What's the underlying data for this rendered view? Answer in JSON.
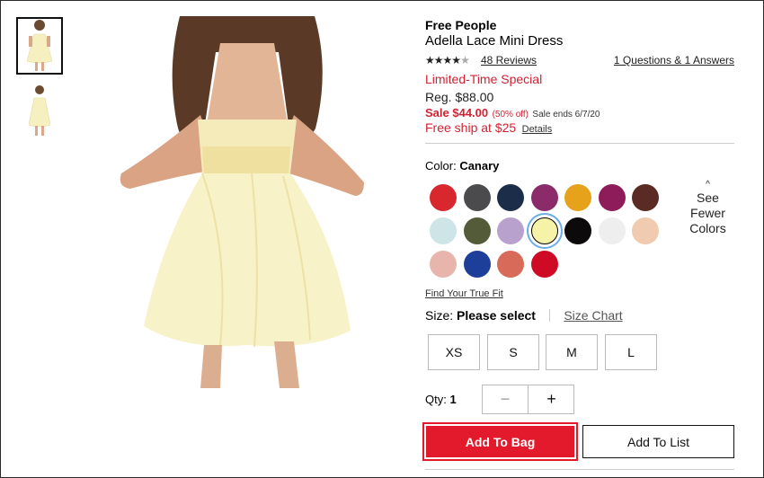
{
  "thumbnails": [
    {
      "name": "thumbnail-front",
      "selected": true
    },
    {
      "name": "thumbnail-back",
      "selected": false
    }
  ],
  "product": {
    "brand": "Free People",
    "name": "Adella Lace Mini Dress",
    "rating": 4,
    "rating_max": 5,
    "reviews_label": "48 Reviews",
    "qa_label": "1 Questions & 1 Answers",
    "promo_label": "Limited-Time Special",
    "regular_price": "Reg. $88.00",
    "sale_price": "Sale $44.00",
    "sale_off": "(50% off)",
    "sale_ends": "Sale ends 6/7/20",
    "shipping": "Free ship at $25",
    "details_label": "Details"
  },
  "color": {
    "label": "Color:",
    "selected": "Canary",
    "see_fewer": [
      "See",
      "Fewer",
      "Colors"
    ],
    "swatches": [
      {
        "color": "#d8282e"
      },
      {
        "color": "#4b4b4d"
      },
      {
        "color": "#1c2d4a"
      },
      {
        "color": "#8b2b6a"
      },
      {
        "color": "#e6a21a"
      },
      {
        "color": "#8e1b5a"
      },
      {
        "color": "#5a2a24"
      },
      {
        "color": "#cde5e6"
      },
      {
        "color": "#545b38"
      },
      {
        "color": "#b8a2cd"
      },
      {
        "color": "#f6f3a8",
        "selected": true
      },
      {
        "color": "#0d0a0c"
      },
      {
        "color": "#eeeeef"
      },
      {
        "color": "#f0cbaf"
      },
      {
        "color": "#e8b5ad"
      },
      {
        "color": "#1d3f9a"
      },
      {
        "color": "#d86a59"
      },
      {
        "color": "#cf0a24"
      }
    ]
  },
  "fit_link": "Find Your True Fit",
  "size": {
    "label": "Size:",
    "selected": "Please select",
    "chart_link": "Size Chart",
    "options": [
      "XS",
      "S",
      "M",
      "L"
    ]
  },
  "quantity": {
    "label": "Qty:",
    "value": "1",
    "minus": "−",
    "plus": "+"
  },
  "actions": {
    "add_to_bag": "Add To Bag",
    "add_to_list": "Add To List"
  }
}
